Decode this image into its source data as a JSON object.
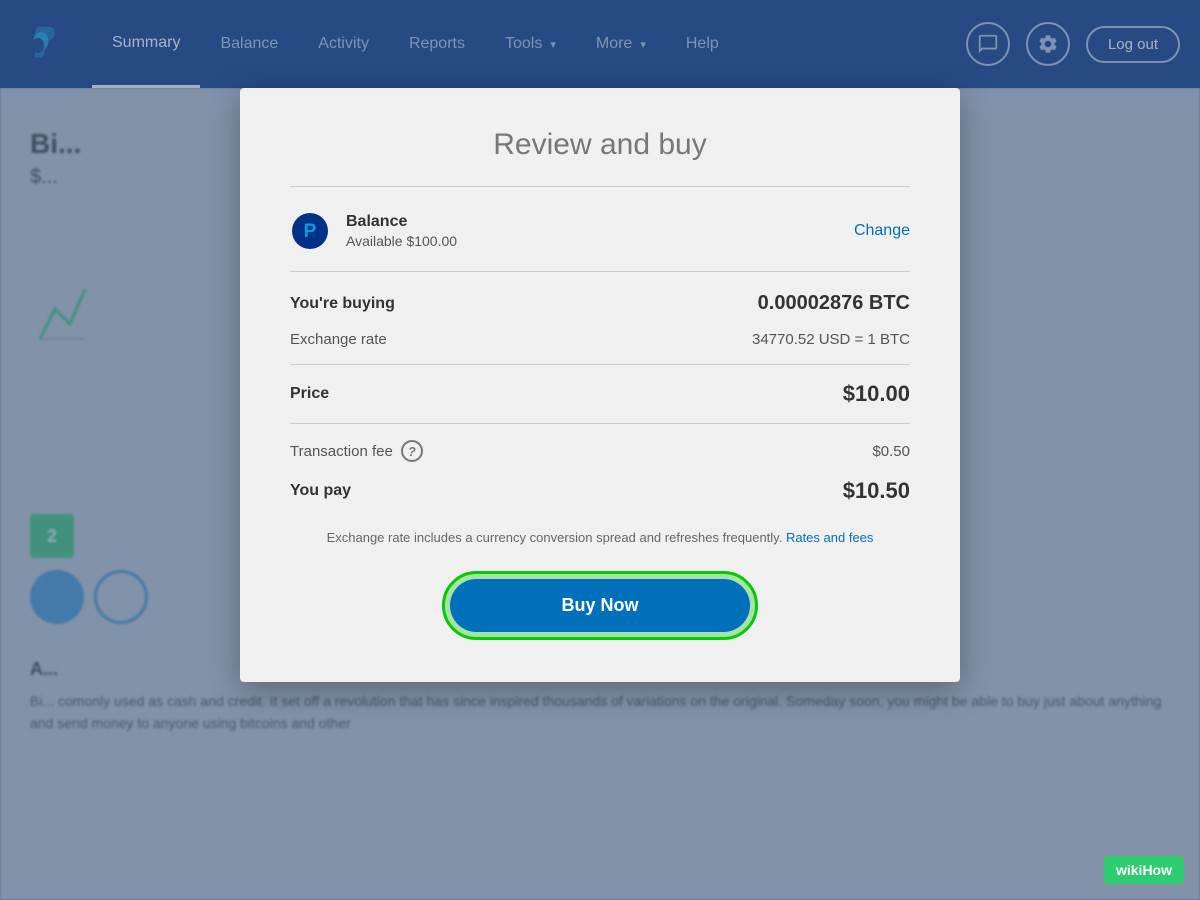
{
  "navbar": {
    "logo_alt": "PayPal",
    "nav_items": [
      {
        "label": "Summary",
        "active": true
      },
      {
        "label": "Balance",
        "active": false
      },
      {
        "label": "Activity",
        "active": false
      },
      {
        "label": "Reports",
        "active": false
      },
      {
        "label": "Tools",
        "active": false,
        "has_arrow": true
      },
      {
        "label": "More",
        "active": false,
        "has_arrow": true
      },
      {
        "label": "Help",
        "active": false
      }
    ],
    "logout_label": "Log out"
  },
  "background": {
    "title": "Bi...",
    "subtitle": "$...",
    "badge_number": "2",
    "about_label": "A...",
    "body_text": "Bi... comonly used as cash and credit. It set off a revolution that has since inspired thousands of variations on the original. Someday soon, you might be able to buy just about anything and send money to anyone using bitcoins and other"
  },
  "modal": {
    "title": "Review and buy",
    "payment_method": {
      "label": "Balance",
      "available": "Available $100.00",
      "change_label": "Change"
    },
    "buying_label": "You're buying",
    "buying_amount": "0.00002876 BTC",
    "exchange_rate_label": "Exchange rate",
    "exchange_rate_value": "34770.52 USD = 1 BTC",
    "price_label": "Price",
    "price_value": "$10.00",
    "transaction_fee_label": "Transaction fee",
    "transaction_fee_value": "$0.50",
    "you_pay_label": "You pay",
    "you_pay_value": "$10.50",
    "disclaimer_text": "Exchange rate includes a currency conversion spread and refreshes frequently.",
    "rates_link_label": "Rates and fees",
    "buy_button_label": "Buy Now"
  },
  "wikihow_badge": "wikiHow"
}
